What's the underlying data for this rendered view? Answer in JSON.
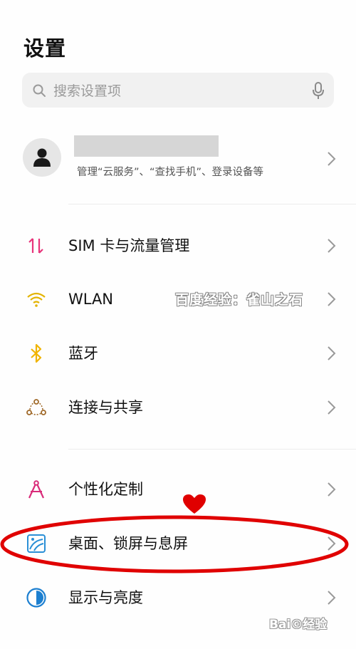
{
  "header": {
    "title": "设置"
  },
  "search": {
    "placeholder": "搜索设置项",
    "icon": "search-icon",
    "mic_icon": "microphone-icon"
  },
  "account": {
    "avatar_icon": "person-icon",
    "description": "管理“云服务”、“查找手机”、登录设备等"
  },
  "settings": [
    {
      "label": "SIM 卡与流量管理",
      "icon": "sim-data-icon",
      "color": "#e8347a"
    },
    {
      "label": "WLAN",
      "icon": "wifi-icon",
      "color": "#e3b300"
    },
    {
      "label": "蓝牙",
      "icon": "bluetooth-icon",
      "color": "#f0b400"
    },
    {
      "label": "连接与共享",
      "icon": "share-connect-icon",
      "color": "#a06a2a"
    },
    {
      "label": "个性化定制",
      "icon": "compass-personalize-icon",
      "color": "#d92c7a"
    },
    {
      "label": "桌面、锁屏与息屏",
      "icon": "wallpaper-icon",
      "color": "#2a8fd6"
    },
    {
      "label": "显示与亮度",
      "icon": "display-brightness-icon",
      "color": "#1c7fd0"
    }
  ],
  "watermark": "百度经验：雀山之石",
  "logo_text": "Bai©经验",
  "annotation": {
    "ellipse_color": "#e00000",
    "heart_color": "#e00000"
  }
}
